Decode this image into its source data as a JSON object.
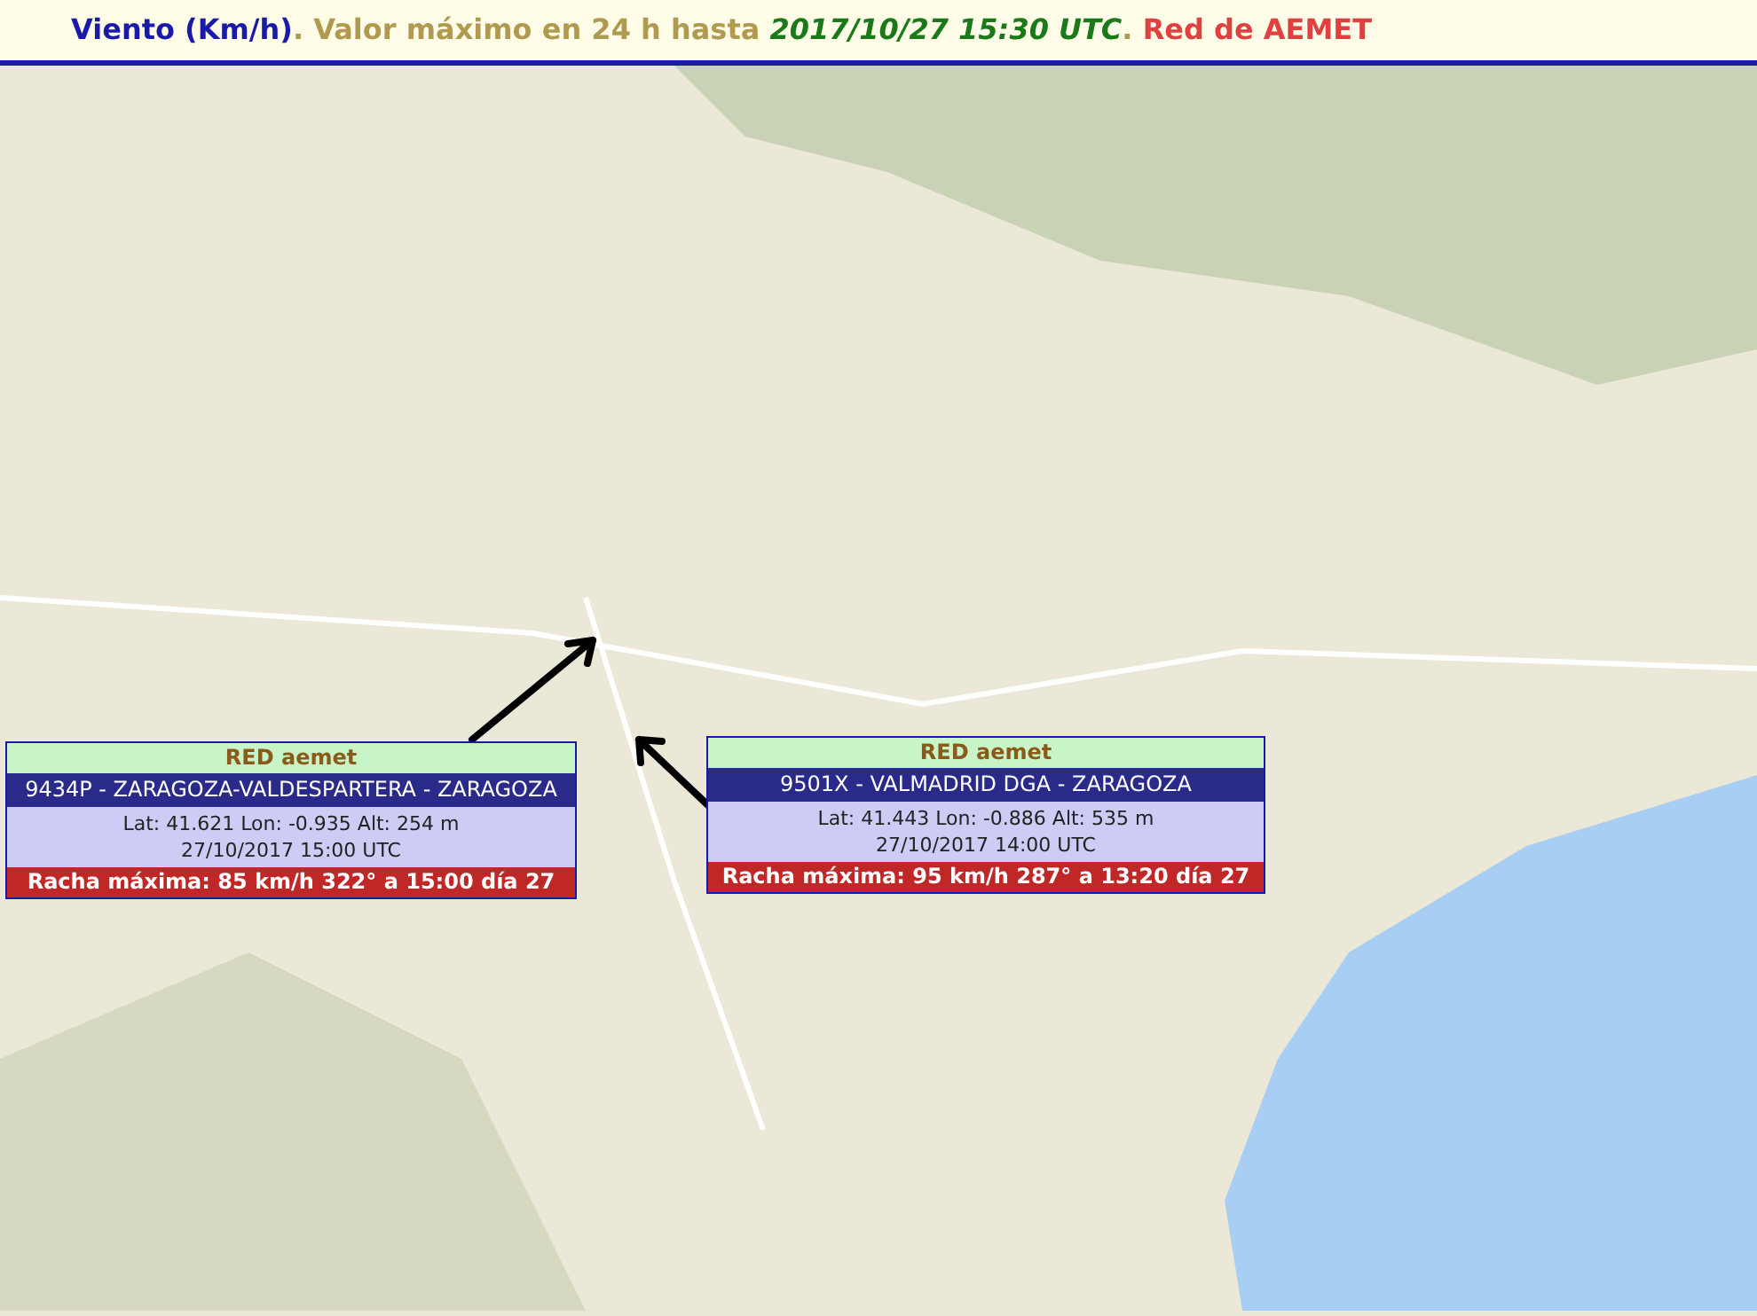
{
  "header": {
    "parts": [
      {
        "kind": "variable",
        "text": "Viento (Km/h)"
      },
      {
        "kind": "plain",
        "text": ". Valor máximo en 24 h hasta "
      },
      {
        "kind": "time",
        "text": "2017/10/27 15:30 UTC"
      },
      {
        "kind": "plain",
        "text": ". "
      },
      {
        "kind": "network",
        "text": "Red de AEMET"
      }
    ]
  },
  "popups": [
    {
      "network": "RED aemet",
      "station": "9434P - ZARAGOZA-VALDESPARTERA - ZARAGOZA",
      "coords": "Lat: 41.621 Lon: -0.935 Alt: 254 m",
      "time": "27/10/2017 15:00 UTC",
      "gust": "Racha máxima: 85 km/h 322° a 15:00 día 27"
    },
    {
      "network": "RED aemet",
      "station": "9501X - VALMADRID DGA - ZARAGOZA",
      "coords": "Lat: 41.443 Lon: -0.886 Alt: 535 m",
      "time": "27/10/2017 14:00 UTC",
      "gust": "Racha máxima: 95 km/h 287° a 13:20 día 27"
    }
  ]
}
